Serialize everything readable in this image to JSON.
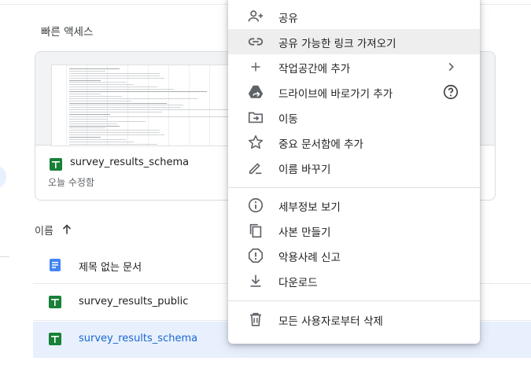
{
  "quick_access": {
    "title": "빠른 액세스",
    "card": {
      "file_name": "survey_results_schema",
      "subtitle": "오늘 수정함"
    }
  },
  "list": {
    "sort_label": "이름",
    "files": [
      {
        "name": "제목 없는 문서",
        "type": "doc"
      },
      {
        "name": "survey_results_public",
        "type": "sheet"
      },
      {
        "name": "survey_results_schema",
        "type": "sheet",
        "selected": true
      }
    ]
  },
  "context_menu": {
    "items": [
      {
        "label": "공유",
        "icon": "person-add-icon"
      },
      {
        "label": "공유 가능한 링크 가져오기",
        "icon": "link-icon",
        "highlighted": true
      },
      {
        "label": "작업공간에 추가",
        "icon": "plus-icon"
      },
      {
        "label": "드라이브에 바로가기 추가",
        "icon": "drive-shortcut-icon"
      },
      {
        "label": "이동",
        "icon": "move-to-folder-icon"
      },
      {
        "label": "중요 문서함에 추가",
        "icon": "star-icon"
      },
      {
        "label": "이름 바꾸기",
        "icon": "pencil-icon"
      },
      {
        "label": "세부정보 보기",
        "icon": "info-icon"
      },
      {
        "label": "사본 만들기",
        "icon": "copy-icon"
      },
      {
        "label": "악용사례 신고",
        "icon": "report-icon"
      },
      {
        "label": "다운로드",
        "icon": "download-icon"
      },
      {
        "label": "모든 사용자로부터 삭제",
        "icon": "trash-icon"
      }
    ]
  },
  "colors": {
    "sheets_green": "#188038",
    "docs_blue": "#4285f4",
    "selected_bg": "#e8f0fe",
    "selected_text": "#1967d2",
    "icon_gray": "#5f6368"
  }
}
